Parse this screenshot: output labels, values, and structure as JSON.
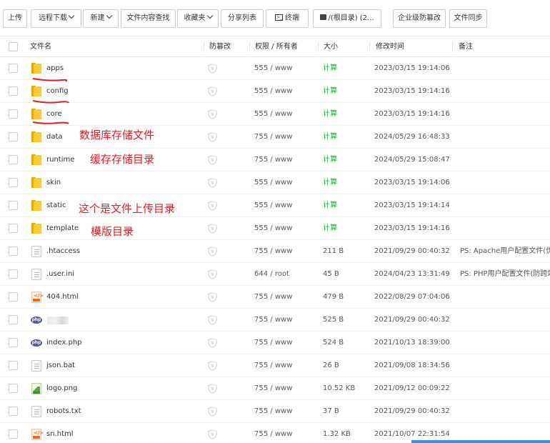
{
  "toolbar": {
    "upload": "上传",
    "remote_download": "远程下载",
    "new": "新建",
    "content_search": "文件内容查找",
    "favorites": "收藏夹",
    "share_list": "分享列表",
    "terminal": "终端",
    "path": "/(根目录) (2...",
    "enterprise_tamper": "企业级防篡改",
    "file_sync": "文件同步"
  },
  "header": {
    "name": "文件名",
    "tamper": "防篡改",
    "perm_owner": "权限 / 所有者",
    "size": "大小",
    "mtime": "修改时间",
    "note": "备注"
  },
  "files": [
    {
      "name": "apps",
      "type": "folder",
      "perm": "555 / www",
      "size": "计算",
      "mtime": "2023/03/15 19:14:06",
      "note": ""
    },
    {
      "name": "config",
      "type": "folder",
      "perm": "555 / www",
      "size": "计算",
      "mtime": "2023/03/15 19:14:16",
      "note": ""
    },
    {
      "name": "core",
      "type": "folder",
      "perm": "555 / www",
      "size": "计算",
      "mtime": "2023/03/15 19:14:16",
      "note": ""
    },
    {
      "name": "data",
      "type": "folder",
      "perm": "755 / www",
      "size": "计算",
      "mtime": "2024/05/29 16:48:33",
      "note": ""
    },
    {
      "name": "runtime",
      "type": "folder",
      "perm": "755 / www",
      "size": "计算",
      "mtime": "2024/05/29 15:08:47",
      "note": ""
    },
    {
      "name": "skin",
      "type": "folder",
      "perm": "555 / www",
      "size": "计算",
      "mtime": "2023/03/15 19:14:06",
      "note": ""
    },
    {
      "name": "static",
      "type": "folder",
      "perm": "555 / www",
      "size": "计算",
      "mtime": "2023/03/15 19:14:14",
      "note": ""
    },
    {
      "name": "template",
      "type": "folder",
      "perm": "555 / www",
      "size": "计算",
      "mtime": "2023/03/15 19:14:16",
      "note": ""
    },
    {
      "name": ".htaccess",
      "type": "doc",
      "perm": "755 / www",
      "size": "211 B",
      "mtime": "2021/09/29 00:40:32",
      "note": "PS: Apache用户配置文件(伪静"
    },
    {
      "name": ".user.ini",
      "type": "doc",
      "perm": "644 / root",
      "size": "45 B",
      "mtime": "2024/04/23 13:31:49",
      "note": "PS: PHP用户配置文件(防跨站"
    },
    {
      "name": "404.html",
      "type": "html",
      "perm": "755 / www",
      "size": "479 B",
      "mtime": "2022/08/29 07:04:06",
      "note": ""
    },
    {
      "name": "",
      "type": "php",
      "perm": "755 / www",
      "size": "525 B",
      "mtime": "2021/09/29 00:40:32",
      "note": ""
    },
    {
      "name": "index.php",
      "type": "php",
      "perm": "755 / www",
      "size": "524 B",
      "mtime": "2021/10/13 18:39:00",
      "note": ""
    },
    {
      "name": "json.bat",
      "type": "doc",
      "perm": "755 / www",
      "size": "26 B",
      "mtime": "2021/09/08 18:34:56",
      "note": ""
    },
    {
      "name": "logo.png",
      "type": "png",
      "perm": "755 / www",
      "size": "10.52 KB",
      "mtime": "2021/09/12 00:09:22",
      "note": ""
    },
    {
      "name": "robots.txt",
      "type": "doc",
      "perm": "755 / www",
      "size": "37 B",
      "mtime": "2021/09/29 00:40:32",
      "note": ""
    },
    {
      "name": "sn.html",
      "type": "html",
      "perm": "755 / www",
      "size": "1.32 KB",
      "mtime": "2021/10/07 22:31:54",
      "note": ""
    }
  ],
  "annotations": {
    "data": "数据库存储文件",
    "runtime": "缓存存储目录",
    "static": "这个是文件上传目录",
    "template": "模版目录"
  },
  "colors": {
    "annotation": "#e51c23",
    "calc": "#20a53a",
    "folder": "#fcc93b"
  }
}
